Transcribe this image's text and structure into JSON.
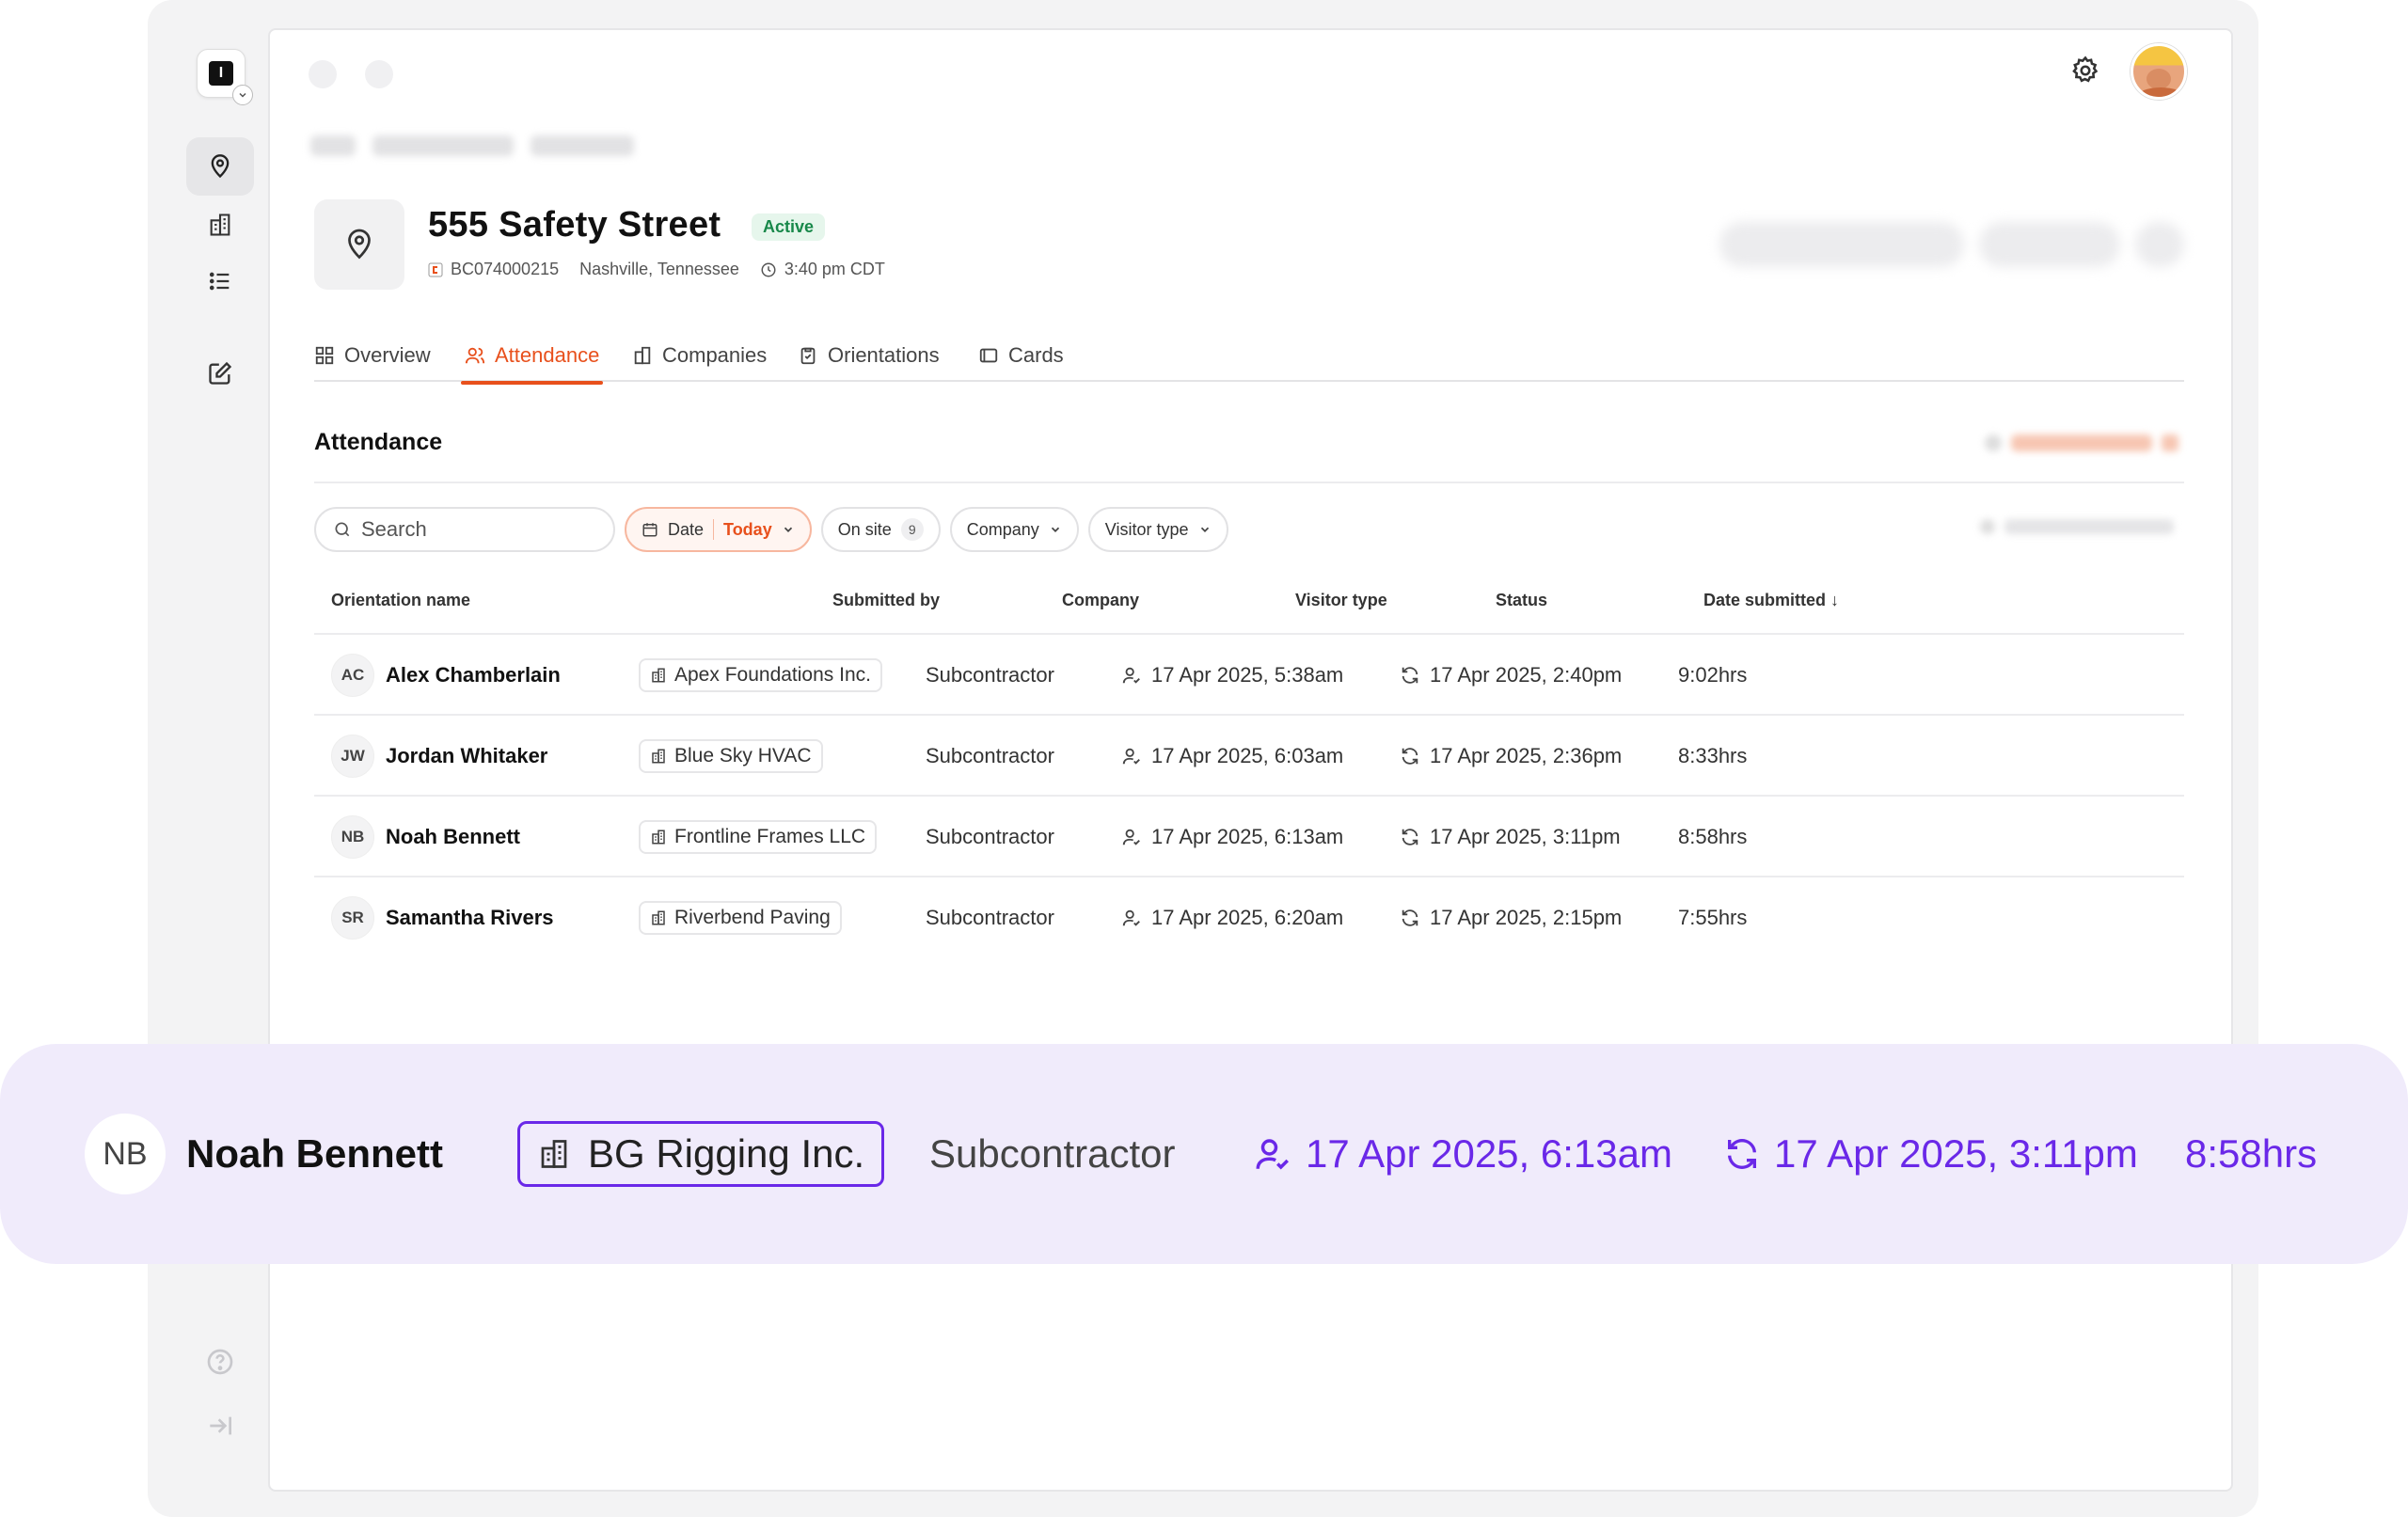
{
  "app": {
    "logo_letter": "I"
  },
  "header": {
    "site_name": "555 Safety Street",
    "status_badge": "Active",
    "site_code": "BC074000215",
    "location": "Nashville, Tennessee",
    "local_time": "3:40 pm CDT"
  },
  "tabs": [
    {
      "label": "Overview",
      "icon": "grid-icon",
      "active": false
    },
    {
      "label": "Attendance",
      "icon": "users-icon",
      "active": true
    },
    {
      "label": "Companies",
      "icon": "building-icon",
      "active": false
    },
    {
      "label": "Orientations",
      "icon": "clipboard-icon",
      "active": false
    },
    {
      "label": "Cards",
      "icon": "card-icon",
      "active": false
    }
  ],
  "attendance": {
    "title": "Attendance",
    "search_placeholder": "Search",
    "filters": {
      "date_label": "Date",
      "date_value": "Today",
      "on_site_label": "On site",
      "on_site_count": "9",
      "company_label": "Company",
      "visitor_type_label": "Visitor type"
    },
    "columns": [
      "Orientation name",
      "Submitted by",
      "Company",
      "Visitor type",
      "Status",
      "Date submitted ↓"
    ],
    "rows": [
      {
        "initials": "AC",
        "name": "Alex Chamberlain",
        "company": "Apex Foundations Inc.",
        "visitor_type": "Subcontractor",
        "check_in": "17 Apr 2025, 5:38am",
        "check_out": "17 Apr 2025, 2:40pm",
        "duration": "9:02hrs"
      },
      {
        "initials": "JW",
        "name": "Jordan Whitaker",
        "company": "Blue Sky HVAC",
        "visitor_type": "Subcontractor",
        "check_in": "17 Apr 2025, 6:03am",
        "check_out": "17 Apr 2025, 2:36pm",
        "duration": "8:33hrs"
      },
      {
        "initials": "NB",
        "name": "Noah Bennett",
        "company": "Frontline Frames LLC",
        "visitor_type": "Subcontractor",
        "check_in": "17 Apr 2025, 6:13am",
        "check_out": "17 Apr 2025, 3:11pm",
        "duration": "8:58hrs"
      },
      {
        "initials": "SR",
        "name": "Samantha Rivers",
        "company": "Riverbend Paving",
        "visitor_type": "Subcontractor",
        "check_in": "17 Apr 2025, 6:20am",
        "check_out": "17 Apr 2025, 2:15pm",
        "duration": "7:55hrs"
      }
    ]
  },
  "highlight_row": {
    "initials": "NB",
    "name": "Noah Bennett",
    "company": "BG Rigging Inc.",
    "visitor_type": "Subcontractor",
    "check_in": "17 Apr 2025, 6:13am",
    "check_out": "17 Apr 2025, 3:11pm",
    "duration": "8:58hrs"
  },
  "colors": {
    "accent_orange": "#e8501c",
    "highlight_purple": "#6a28e8",
    "highlight_band": "#f0ebfb",
    "active_green": "#18884a"
  }
}
